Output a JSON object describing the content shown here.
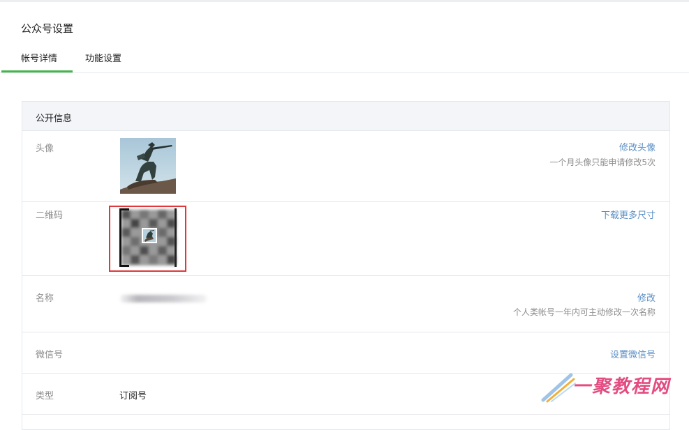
{
  "page": {
    "title": "公众号设置"
  },
  "tabs": [
    {
      "label": "帐号详情",
      "active": true
    },
    {
      "label": "功能设置",
      "active": false
    }
  ],
  "colors": {
    "accent_green": "#44b549",
    "link_blue": "#5b8fc6",
    "highlight_red": "#e0383b"
  },
  "panel": {
    "title": "公开信息",
    "rows": [
      {
        "label": "头像",
        "link": "修改头像",
        "tip": "一个月头像只能申请修改5次"
      },
      {
        "label": "二维码",
        "link": "下载更多尺寸"
      },
      {
        "label": "名称",
        "link": "修改",
        "tip": "个人类帐号一年内可主动修改一次名称"
      },
      {
        "label": "微信号",
        "link": "设置微信号"
      },
      {
        "label": "类型",
        "value": "订阅号"
      }
    ]
  },
  "watermark": {
    "text": "一聚教程网"
  }
}
